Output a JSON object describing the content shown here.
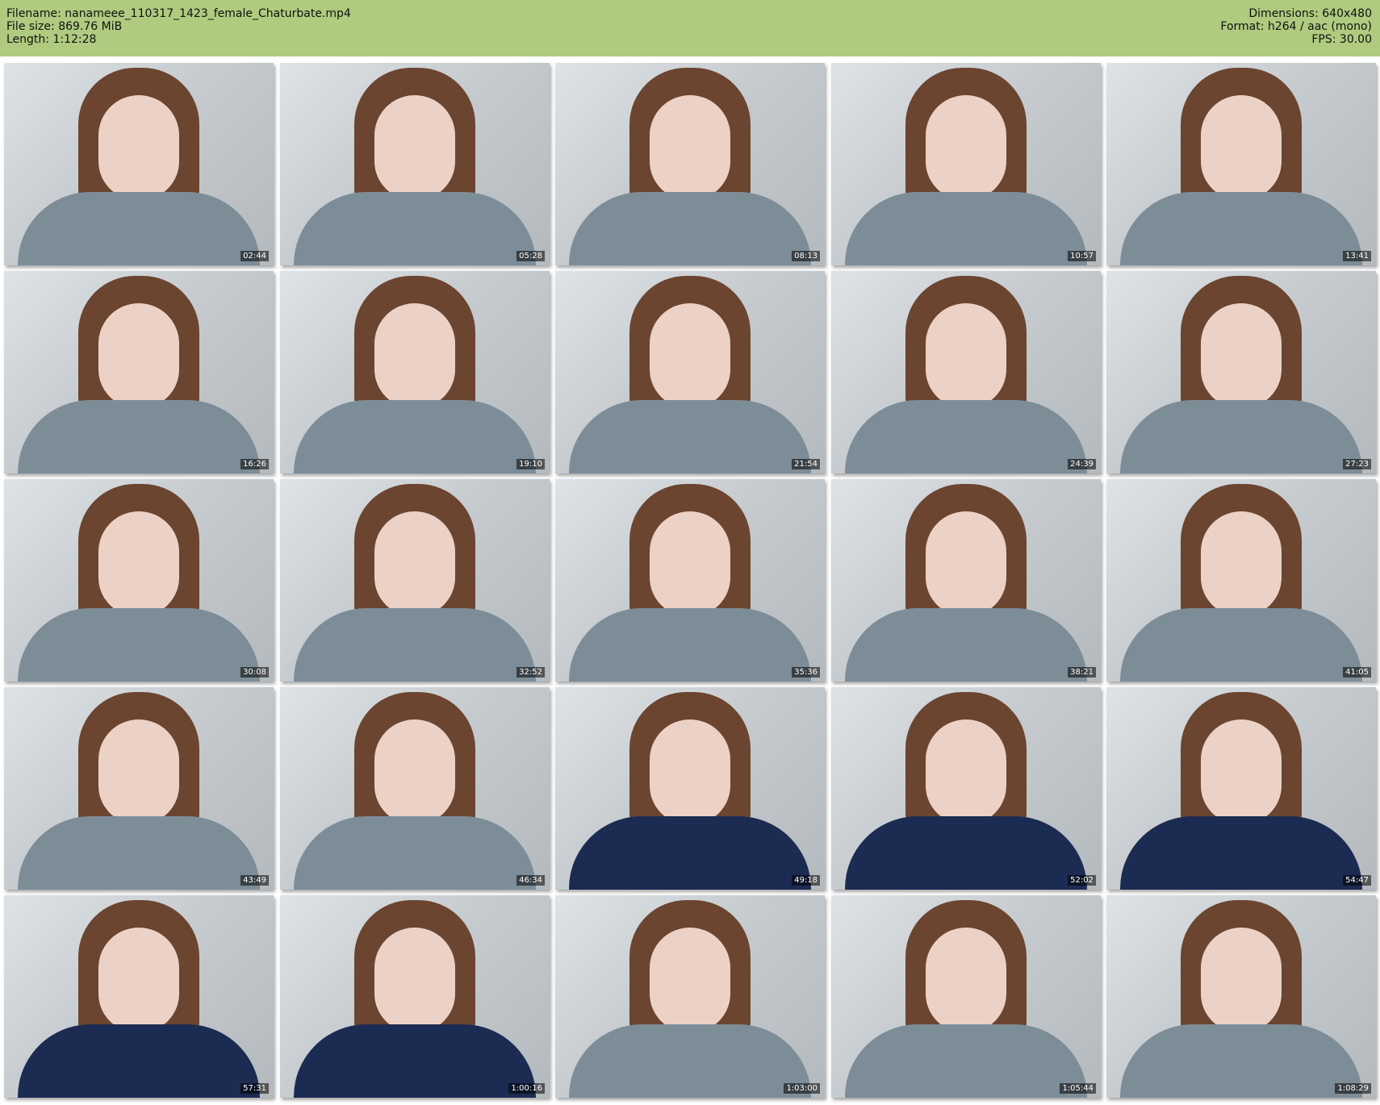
{
  "header": {
    "filename": "Filename: nanameee_110317_1423_female_Chaturbate.mp4",
    "filesize": "File size: 869.76 MiB",
    "length": "Length: 1:12:28",
    "dimensions": "Dimensions: 640x480",
    "format": "Format: h264 / aac (mono)",
    "fps": "FPS: 30.00"
  },
  "colors": {
    "header_bg": "#aecb7f"
  },
  "thumbnails": [
    {
      "time": "02:44"
    },
    {
      "time": "05:28"
    },
    {
      "time": "08:13"
    },
    {
      "time": "10:57"
    },
    {
      "time": "13:41"
    },
    {
      "time": "16:26"
    },
    {
      "time": "19:10"
    },
    {
      "time": "21:54"
    },
    {
      "time": "24:39"
    },
    {
      "time": "27:23"
    },
    {
      "time": "30:08"
    },
    {
      "time": "32:52"
    },
    {
      "time": "35:36"
    },
    {
      "time": "38:21"
    },
    {
      "time": "41:05"
    },
    {
      "time": "43:49"
    },
    {
      "time": "46:34"
    },
    {
      "time": "49:18"
    },
    {
      "time": "52:02"
    },
    {
      "time": "54:47"
    },
    {
      "time": "57:31"
    },
    {
      "time": "1:00:16"
    },
    {
      "time": "1:03:00"
    },
    {
      "time": "1:05:44"
    },
    {
      "time": "1:08:29"
    }
  ]
}
